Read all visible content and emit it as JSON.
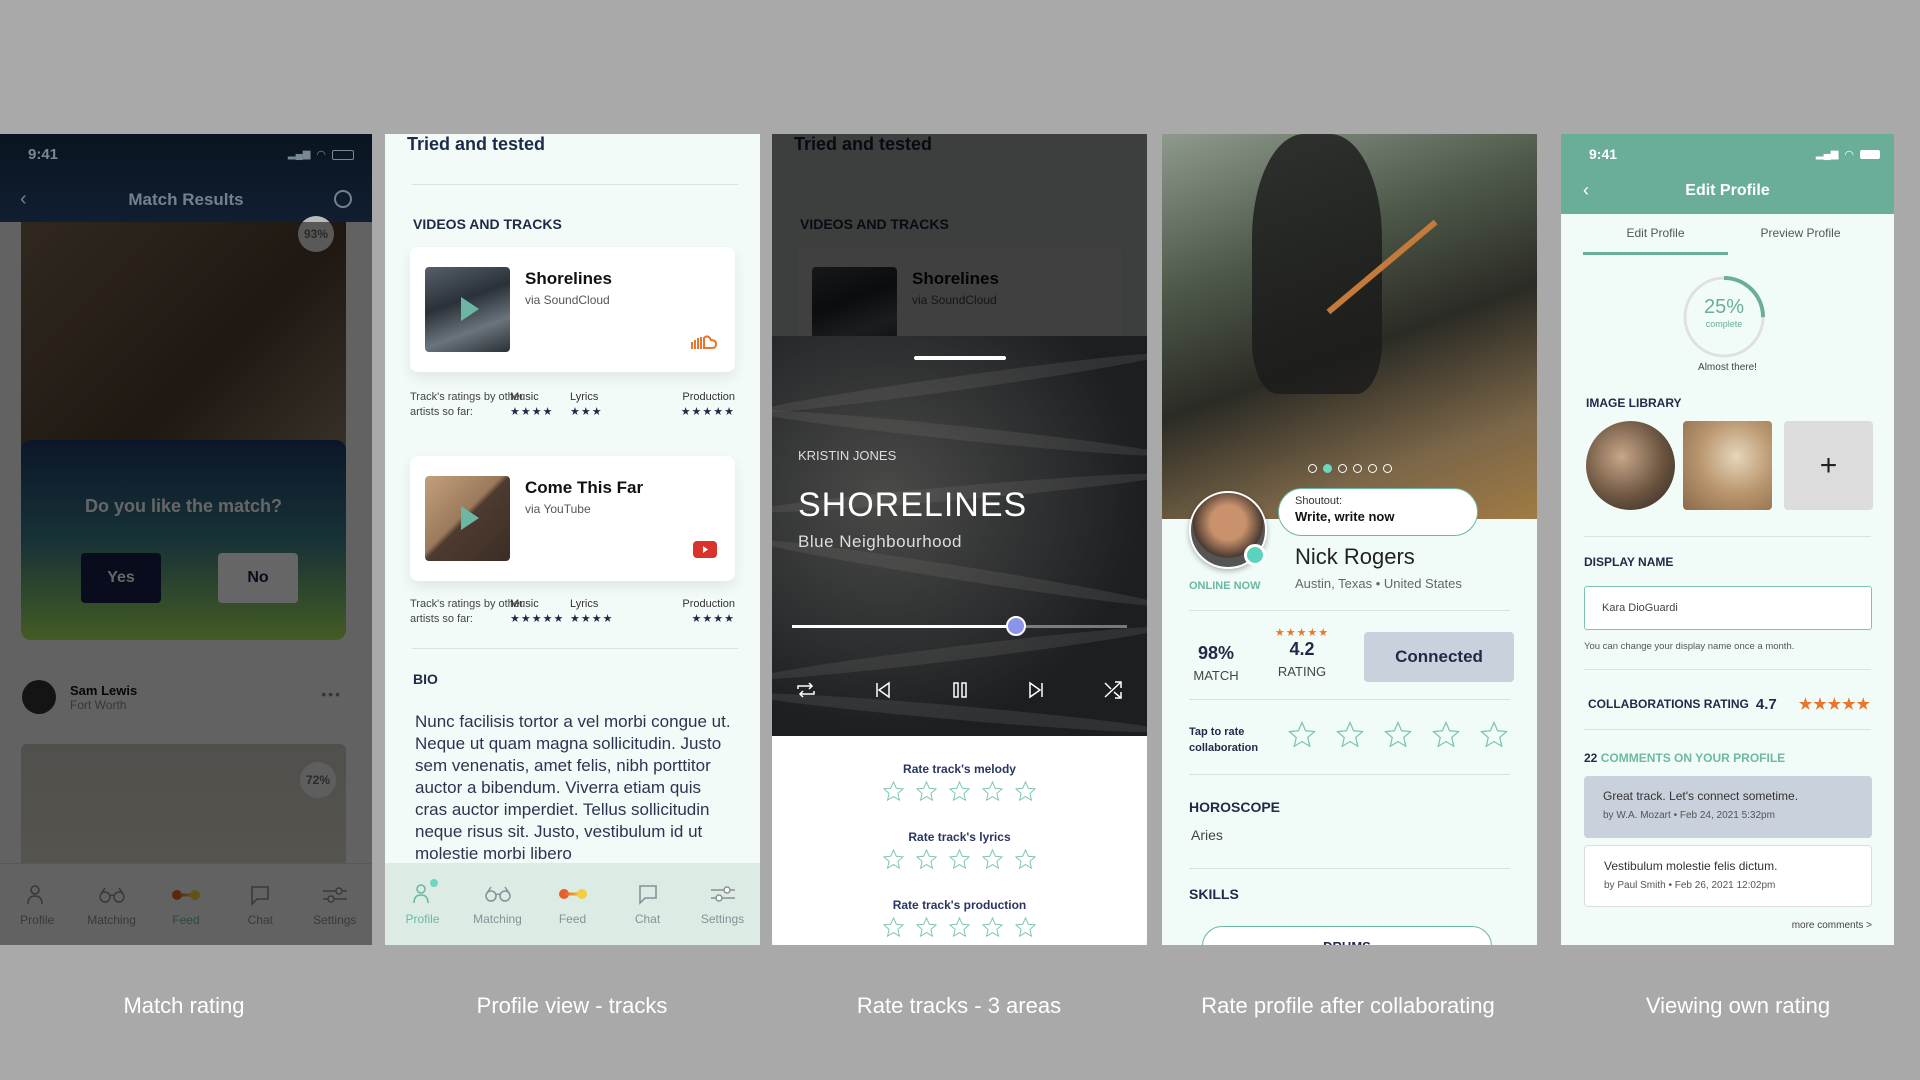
{
  "captions": [
    "Match rating",
    "Profile view - tracks",
    "Rate tracks - 3 areas",
    "Rate profile after collaborating",
    "Viewing own rating"
  ],
  "tabbar": [
    {
      "label": "Profile",
      "icon": "profile-icon"
    },
    {
      "label": "Matching",
      "icon": "glasses-icon"
    },
    {
      "label": "Feed",
      "icon": "feed-icon"
    },
    {
      "label": "Chat",
      "icon": "chat-icon"
    },
    {
      "label": "Settings",
      "icon": "sliders-icon"
    }
  ],
  "match_screen": {
    "time": "9:41",
    "title": "Match Results",
    "top_match_percent": "93%",
    "question": "Do you like the match?",
    "yes_label": "Yes",
    "no_label": "No",
    "user": {
      "name": "Sam Lewis",
      "location": "Fort Worth"
    },
    "second_match_percent": "72%",
    "active_tab": "Feed"
  },
  "profile_tracks": {
    "header": "Tried and tested",
    "section_title": "VIDEOS AND TRACKS",
    "ratings_label": "Track's ratings by other artists so far:",
    "tracks": [
      {
        "title": "Shorelines",
        "source": "via SoundCloud",
        "source_icon": "soundcloud-icon",
        "ratings": [
          {
            "label": "Music",
            "stars": 4
          },
          {
            "label": "Lyrics",
            "stars": 3
          },
          {
            "label": "Production",
            "stars": 5
          }
        ]
      },
      {
        "title": "Come This Far",
        "source": "via YouTube",
        "source_icon": "youtube-icon",
        "ratings": [
          {
            "label": "Music",
            "stars": 5
          },
          {
            "label": "Lyrics",
            "stars": 4
          },
          {
            "label": "Production",
            "stars": 4
          }
        ]
      }
    ],
    "bio_title": "BIO",
    "bio": "Nunc facilisis tortor a vel morbi congue ut. Neque ut quam magna sollicitudin. Justo sem venenatis, amet felis, nibh porttitor auctor a bibendum. Viverra etiam quis cras auctor imperdiet. Tellus sollicitudin neque risus sit. Justo, vestibulum id ut molestie morbi libero",
    "active_tab": "Profile"
  },
  "rate_tracks": {
    "background_header": "Tried and tested",
    "background_section": "VIDEOS AND TRACKS",
    "background_track_title": "Shorelines",
    "background_track_source": "via SoundCloud",
    "artist": "KRISTIN JONES",
    "title": "SHORELINES",
    "album": "Blue Neighbourhood",
    "progress": 0.67,
    "controls": [
      "repeat-icon",
      "previous-icon",
      "pause-icon",
      "next-icon",
      "shuffle-icon"
    ],
    "rate_areas": [
      {
        "label": "Rate track's melody",
        "stars": 0
      },
      {
        "label": "Rate track's lyrics",
        "stars": 0
      },
      {
        "label": "Rate track's production",
        "stars": 0
      }
    ]
  },
  "rate_profile": {
    "carousel_count": 6,
    "carousel_active": 1,
    "shoutout_label": "Shoutout:",
    "shoutout_text": "Write, write now",
    "online_status": "ONLINE NOW",
    "name": "Nick Rogers",
    "location": "Austin, Texas • United States",
    "match_value": "98%",
    "match_label": "MATCH",
    "rating_value": "4.2",
    "rating_label": "RATING",
    "rating_stars": "★★★★★",
    "connect_label": "Connected",
    "tap_to_rate": "Tap to rate collaboration",
    "collab_stars": 0,
    "horoscope_title": "HOROSCOPE",
    "horoscope_value": "Aries",
    "skills_title": "SKILLS",
    "skills": [
      "DRUMS"
    ]
  },
  "own_rating": {
    "time": "9:41",
    "title": "Edit Profile",
    "tabs": [
      "Edit Profile",
      "Preview Profile"
    ],
    "active_tab": "Edit Profile",
    "completion_percent": 25,
    "completion_text": "25%",
    "completion_label": "complete",
    "completion_note": "Almost there!",
    "image_library_title": "IMAGE LIBRARY",
    "add_image_label": "+",
    "display_name_title": "DISPLAY NAME",
    "display_name_value": "Kara DioGuardi",
    "display_name_hint": "You can change your display name once a month.",
    "collab_rating_label": "COLLABORATIONS RATING",
    "collab_rating_value": "4.7",
    "collab_rating_stars": "★★★★★",
    "comments_count": "22",
    "comments_title": "COMMENTS ON YOUR PROFILE",
    "comments": [
      {
        "text": "Great track. Let's connect sometime.",
        "meta": "by W.A. Mozart • Feb 24, 2021 5:32pm"
      },
      {
        "text": "Vestibulum molestie felis dictum.",
        "meta": "by Paul Smith • Feb 26, 2021 12:02pm"
      }
    ],
    "more_comments": "more comments >"
  },
  "colors": {
    "accent": "#6aae99",
    "rating_orange": "#e8772e",
    "navy": "#1f2a48",
    "star_outline": "#7cc4ae"
  }
}
